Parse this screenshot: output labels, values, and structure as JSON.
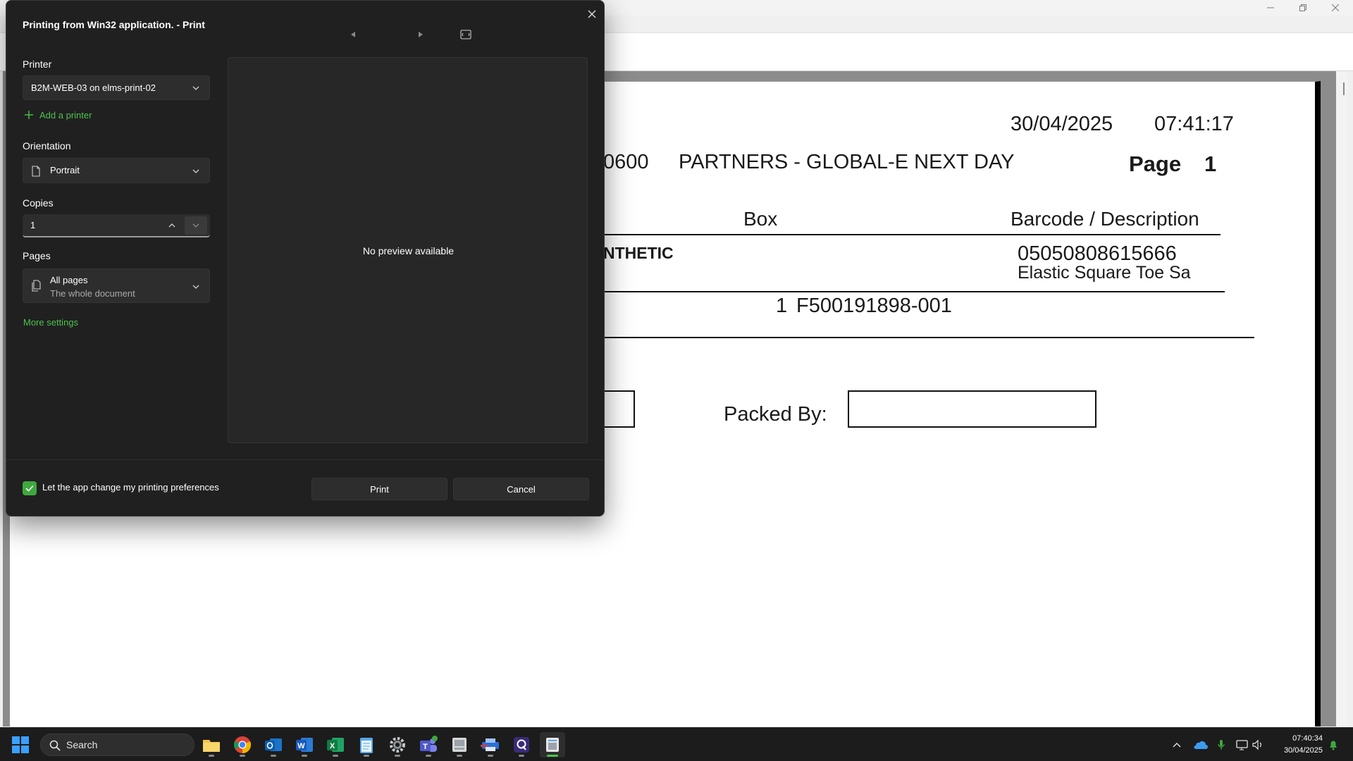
{
  "document": {
    "date": "30/04/2025",
    "time": "07:41:17",
    "header_text": "0600",
    "partner_text": "PARTNERS - GLOBAL-E NEXT DAY",
    "page_label": "Page",
    "page_number": "1",
    "col_box": "Box",
    "col_barcode": "Barcode / Description",
    "item_name": "NTHETIC",
    "barcode": "05050808615666",
    "description": "Elastic Square Toe Sa",
    "box_qty": "1",
    "box_ref": "F500191898-001",
    "packed_by_label": "Packed By:"
  },
  "dialog": {
    "title": "Printing from Win32 application. - Print",
    "printer_label": "Printer",
    "printer_value": "B2M-WEB-03 on elms-print-02",
    "add_printer": "Add a printer",
    "orientation_label": "Orientation",
    "orientation_value": "Portrait",
    "copies_label": "Copies",
    "copies_value": "1",
    "pages_label": "Pages",
    "pages_value": "All pages",
    "pages_sub": "The whole document",
    "more_settings": "More settings",
    "no_preview": "No preview available",
    "pref_label": "Let the app change my printing preferences",
    "pref_checked": true,
    "print_button": "Print",
    "cancel_button": "Cancel"
  },
  "taskbar": {
    "search_label": "Search",
    "time": "07:40:34",
    "date": "30/04/2025",
    "apps": [
      "file-explorer-icon",
      "chrome-icon",
      "outlook-icon",
      "word-icon",
      "excel-icon",
      "notepad-icon",
      "settings-icon",
      "teams-icon",
      "app-icon",
      "printer-app-icon",
      "app-q-icon",
      "active-window-icon"
    ]
  },
  "colors": {
    "accent_green": "#4cc24c",
    "dialog_bg": "#202020",
    "control_bg": "#2d2d2d",
    "taskbar_bg": "#1c1c1c"
  }
}
